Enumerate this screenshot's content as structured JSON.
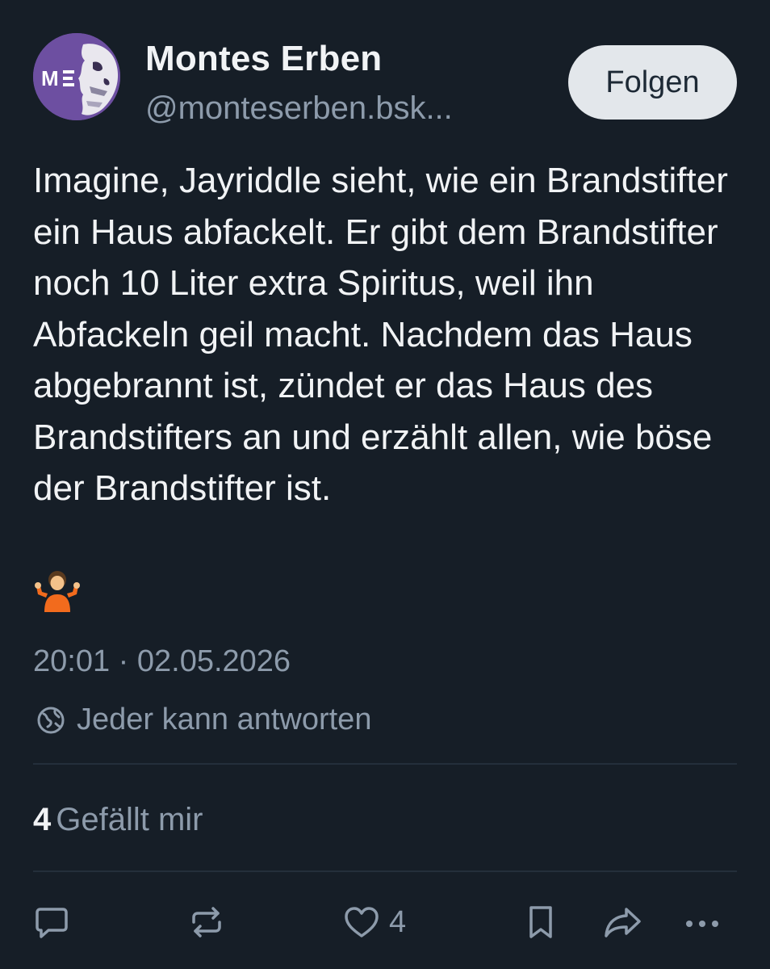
{
  "author": {
    "name": "Montes Erben",
    "handle": "@monteserben.bsk...",
    "avatar_text": "ME"
  },
  "follow_button": {
    "label": "Folgen"
  },
  "post": {
    "text": "Imagine, Jayriddle sieht, wie ein Brandstifter ein Haus abfackelt. Er gibt dem Brandstifter noch 10 Liter extra Spiritus, weil ihn Abfackeln geil macht. Nachdem das Haus abgebrannt ist, zündet er das Haus des Brandstifters an und erzählt allen, wie böse der Brandstifter ist.",
    "emoji": "person-shrugging",
    "timestamp": "20:01 · 02.05.2026"
  },
  "reply_setting": {
    "icon": "globe-icon",
    "label": "Jeder kann antworten"
  },
  "stats": {
    "like_count": "4",
    "like_label": "Gefällt mir"
  },
  "actions": {
    "reply": {
      "icon": "comment-icon"
    },
    "repost": {
      "icon": "repost-icon"
    },
    "like": {
      "icon": "heart-icon",
      "count": "4"
    },
    "bookmark": {
      "icon": "bookmark-icon"
    },
    "share": {
      "icon": "share-icon"
    },
    "more": {
      "icon": "more-icon"
    }
  },
  "colors": {
    "background": "#161e27",
    "text_primary": "#f1f3f5",
    "text_secondary": "#8d9bab",
    "divider": "#242f3b",
    "follow_button_bg": "#e3e7eb",
    "avatar_bg": "#6d4fa1"
  }
}
